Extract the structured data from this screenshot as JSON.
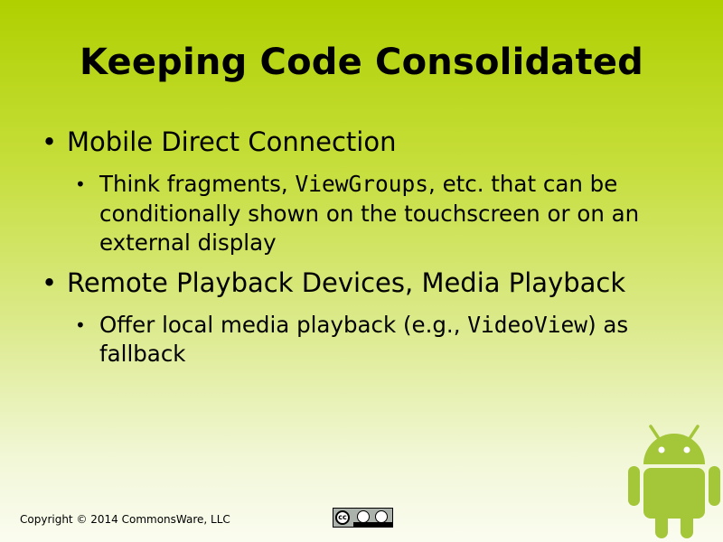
{
  "slide": {
    "title": "Keeping Code Consolidated",
    "items": [
      {
        "text": "Mobile Direct Connection",
        "sub": {
          "before": "Think fragments, ",
          "code": "ViewGroups",
          "after": ", etc. that can be conditionally shown on the touchscreen or on an external display"
        }
      },
      {
        "text": "Remote Playback Devices, Media Playback",
        "sub": {
          "before": "Offer local media playback (e.g., ",
          "code": "VideoView",
          "after": ") as fallback"
        }
      }
    ],
    "bullet_char": "•"
  },
  "footer": {
    "copyright": "Copyright © 2014 CommonsWare, LLC",
    "license_badge": "cc-by-sa-icon"
  },
  "colors": {
    "background_top": "#b0d000",
    "background_bottom": "#fbfcf0",
    "android_green": "#a4c639"
  },
  "icons": [
    "android-robot-icon",
    "cc-by-sa-icon"
  ]
}
